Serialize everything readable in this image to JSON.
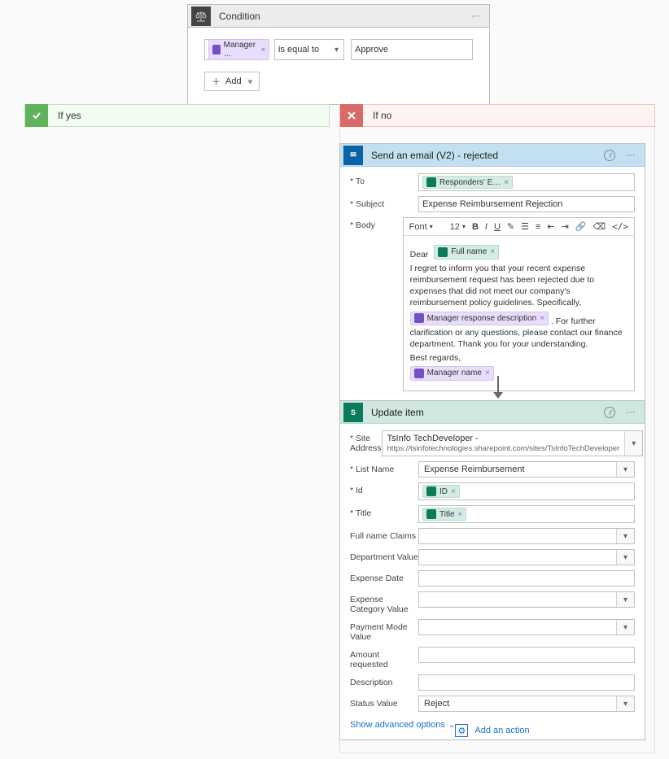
{
  "condition": {
    "title": "Condition",
    "left_token": "Manager …",
    "operator": "is equal to",
    "right_value": "Approve",
    "add_label": "Add"
  },
  "branches": {
    "yes_label": "If yes",
    "no_label": "If no"
  },
  "email": {
    "title": "Send an email (V2) - rejected",
    "fields": {
      "to_label": "* To",
      "to_token": "Responders' E…",
      "subject_label": "* Subject",
      "subject_value": "Expense Reimbursement Rejection",
      "body_label": "* Body"
    },
    "toolbar": {
      "font_label": "Font",
      "size_label": "12"
    },
    "body": {
      "line1": "Dear",
      "token_full_name": "Full name",
      "para1": "I regret to inform you that your recent expense reimbursement request has been rejected due to expenses that did not meet our company's reimbursement policy guidelines. Specifically,",
      "token_mgr_resp": "Manager response description",
      "para2a": ". For further clarification or any questions, please contact our finance department. Thank you for your understanding.",
      "regards": "Best regards,",
      "token_mgr_name": "Manager name"
    },
    "advanced": "Show advanced options"
  },
  "update": {
    "title": "Update item",
    "fields": {
      "site_label": "* Site Address",
      "site_name": "TsInfo TechDeveloper -",
      "site_url": "https://tsinfotechnologies.sharepoint.com/sites/TsInfoTechDeveloper",
      "list_label": "* List Name",
      "list_value": "Expense Reimbursement",
      "id_label": "* Id",
      "id_token": "ID",
      "title_label": "* Title",
      "title_token": "Title",
      "fullname_label": "Full name Claims",
      "dept_label": "Department Value",
      "date_label": "Expense Date",
      "cat_label": "Expense Category Value",
      "pay_label": "Payment Mode Value",
      "amt_label": "Amount requested",
      "desc_label": "Description",
      "status_label": "Status Value",
      "status_value": "Reject"
    },
    "advanced": "Show advanced options"
  },
  "add_action": "Add an action"
}
